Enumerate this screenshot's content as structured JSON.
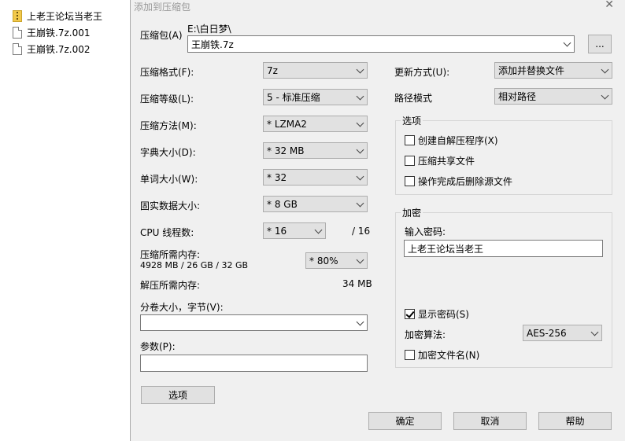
{
  "explorer": {
    "files": [
      {
        "name": "上老王论坛当老王",
        "icon": "zip-folder-icon"
      },
      {
        "name": "王崩铁.7z.001",
        "icon": "file-icon"
      },
      {
        "name": "王崩铁.7z.002",
        "icon": "file-icon"
      }
    ]
  },
  "dialog": {
    "title": "添加到压缩包",
    "archive_label": "压缩包(A)",
    "archive_path": "E:\\白日梦\\",
    "archive_name": "王崩铁.7z",
    "browse_label": "...",
    "format_label": "压缩格式(F):",
    "format_value": "7z",
    "level_label": "压缩等级(L):",
    "level_value": "5 - 标准压缩",
    "method_label": "压缩方法(M):",
    "method_value": "* LZMA2",
    "dict_label": "字典大小(D):",
    "dict_value": "* 32 MB",
    "word_label": "单词大小(W):",
    "word_value": "* 32",
    "solid_label": "固实数据大小:",
    "solid_value": "* 8 GB",
    "cpu_label": "CPU 线程数:",
    "cpu_value": "* 16",
    "cpu_total": "/ 16",
    "mem_comp_label": "压缩所需内存:",
    "mem_comp_value": "4928 MB / 26 GB / 32 GB",
    "mem_percent_value": "* 80%",
    "mem_decomp_label": "解压所需内存:",
    "mem_decomp_value": "34 MB",
    "split_label": "分卷大小，字节(V):",
    "split_value": "",
    "params_label": "参数(P):",
    "params_value": "",
    "options_button": "选项",
    "update_label": "更新方式(U):",
    "update_value": "添加并替换文件",
    "path_label": "路径模式",
    "path_value": "相对路径",
    "options_group": "选项",
    "opt_sfx": "创建自解压程序(X)",
    "opt_shared": "压缩共享文件",
    "opt_delete": "操作完成后删除源文件",
    "encrypt_group": "加密",
    "password_label": "输入密码:",
    "password_value": "上老王论坛当老王",
    "show_password": "显示密码(S)",
    "enc_method_label": "加密算法:",
    "enc_method_value": "AES-256",
    "encrypt_names": "加密文件名(N)",
    "ok_button": "确定",
    "cancel_button": "取消",
    "help_button": "帮助"
  }
}
